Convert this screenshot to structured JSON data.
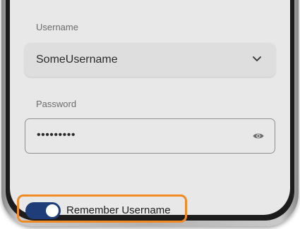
{
  "login_form": {
    "username": {
      "label": "Username",
      "selected_value": "SomeUsername",
      "chevron_icon": "chevron-down-icon"
    },
    "password": {
      "label": "Password",
      "masked_value": "•••••••••",
      "visibility_icon": "eye-icon"
    },
    "remember_username": {
      "label": "Remember Username",
      "enabled": true,
      "toggle_color": "#1f3d78",
      "highlight_color": "#f08a24"
    }
  }
}
